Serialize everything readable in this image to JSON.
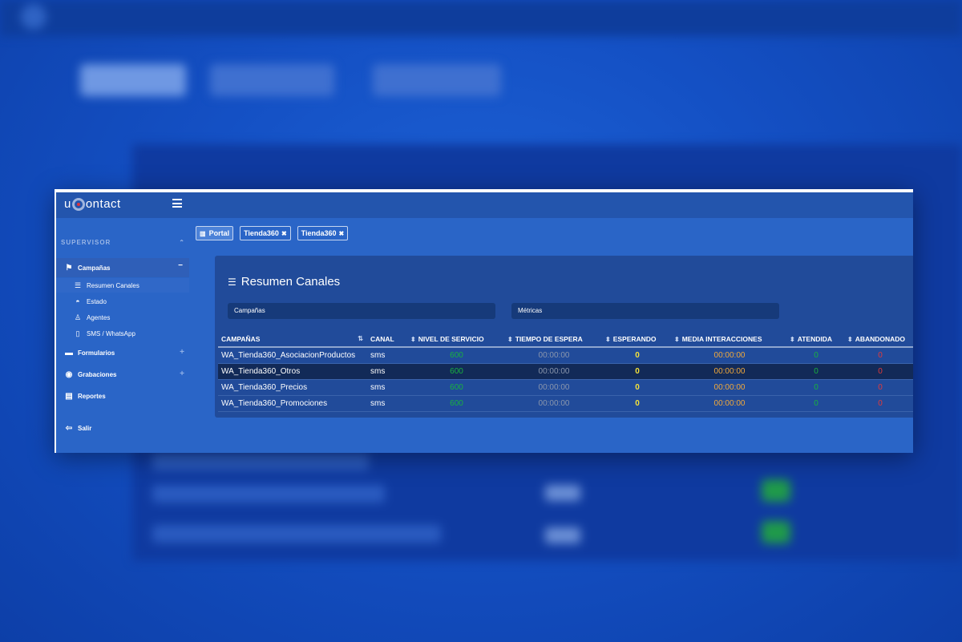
{
  "app": {
    "logo_left": "u",
    "logo_right": "ontact"
  },
  "sidebar": {
    "header": "SUPERVISOR",
    "header_toggle": "⌃",
    "items": [
      {
        "label": "Campañas",
        "toggle": "−",
        "icon": "flag-icon"
      },
      {
        "label": "Formularios",
        "toggle": "+",
        "icon": "folder-icon"
      },
      {
        "label": "Grabaciones",
        "toggle": "+",
        "icon": "play-circle-icon"
      },
      {
        "label": "Reportes",
        "icon": "file-icon"
      },
      {
        "label": "Salir",
        "icon": "sign-out-icon"
      }
    ],
    "subitems": [
      {
        "label": "Resumen Canales",
        "icon": "table-icon"
      },
      {
        "label": "Estado",
        "icon": "dashboard-icon"
      },
      {
        "label": "Agentes",
        "icon": "user-icon"
      },
      {
        "label": "SMS / WhatsApp",
        "icon": "mobile-icon"
      }
    ]
  },
  "tabs": [
    {
      "label": "Portal",
      "icon": "bar-chart-icon"
    },
    {
      "label": "Tienda360",
      "close": "✖"
    },
    {
      "label": "Tienda360",
      "close": "✖"
    }
  ],
  "panel": {
    "title": "Resumen Canales",
    "filter_campaigns": "Campañas",
    "filter_metrics": "Métricas"
  },
  "table": {
    "columns": [
      "CAMPAÑAS",
      "CANAL",
      "NIVEL DE SERVICIO",
      "TIEMPO DE ESPERA",
      "ESPERANDO",
      "MEDIA INTERACCIONES",
      "ATENDIDA",
      "ABANDONADO"
    ],
    "rows": [
      [
        "WA_Tienda360_AsociacionProductos",
        "sms",
        "600",
        "00:00:00",
        "0",
        "00:00:00",
        "0",
        "0"
      ],
      [
        "WA_Tienda360_Otros",
        "sms",
        "600",
        "00:00:00",
        "0",
        "00:00:00",
        "0",
        "0"
      ],
      [
        "WA_Tienda360_Precios",
        "sms",
        "600",
        "00:00:00",
        "0",
        "00:00:00",
        "0",
        "0"
      ],
      [
        "WA_Tienda360_Promociones",
        "sms",
        "600",
        "00:00:00",
        "0",
        "00:00:00",
        "0",
        "0"
      ]
    ],
    "selected_row": 1
  },
  "colors": {
    "ok": "#18b23e",
    "muted": "#8a96ad",
    "waiting": "#f5e23a",
    "media": "#f2a93a",
    "abandoned": "#e33a3a"
  }
}
